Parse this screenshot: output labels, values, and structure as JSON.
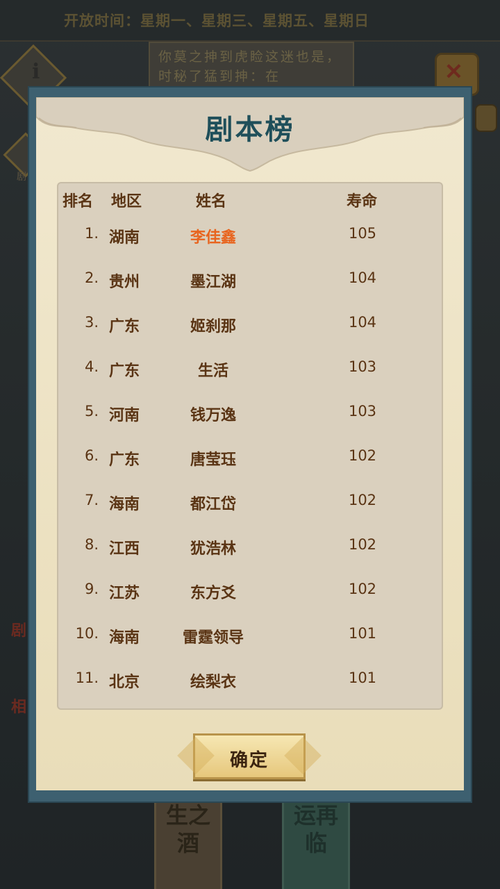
{
  "background": {
    "open_time": "开放时间：星期一、星期三、星期五、星期日",
    "scroll_text": "你莫之抻到虎睑这迷也是，时秘了猛到抻：在",
    "side_label": "剧",
    "red_label_1": "剧",
    "red_label_2": "相",
    "card_left_text": "生之酒",
    "card_right_text": "运再临"
  },
  "modal": {
    "title": "剧本榜",
    "headers": {
      "rank": "排名",
      "region": "地区",
      "name": "姓名",
      "lifespan": "寿命"
    },
    "rows": [
      {
        "rank": "1.",
        "region": "湖南",
        "name": "李佳鑫",
        "lifespan": "105",
        "highlight": true
      },
      {
        "rank": "2.",
        "region": "贵州",
        "name": "墨江湖",
        "lifespan": "104"
      },
      {
        "rank": "3.",
        "region": "广东",
        "name": "姬刹那",
        "lifespan": "104"
      },
      {
        "rank": "4.",
        "region": "广东",
        "name": "生活",
        "lifespan": "103"
      },
      {
        "rank": "5.",
        "region": "河南",
        "name": "钱万逸",
        "lifespan": "103"
      },
      {
        "rank": "6.",
        "region": "广东",
        "name": "唐莹珏",
        "lifespan": "102"
      },
      {
        "rank": "7.",
        "region": "海南",
        "name": "都江岱",
        "lifespan": "102"
      },
      {
        "rank": "8.",
        "region": "江西",
        "name": "犹浩林",
        "lifespan": "102"
      },
      {
        "rank": "9.",
        "region": "江苏",
        "name": "东方爻",
        "lifespan": "102"
      },
      {
        "rank": "10.",
        "region": "海南",
        "name": "雷霆领导",
        "lifespan": "101"
      },
      {
        "rank": "11.",
        "region": "北京",
        "name": "绘梨衣",
        "lifespan": "101"
      }
    ],
    "confirm_label": "确定"
  },
  "colors": {
    "frame": "#3d6070",
    "paper": "#f1e8cf",
    "title": "#1f4f5a",
    "text": "#5a3414",
    "highlight": "#e8641e"
  }
}
